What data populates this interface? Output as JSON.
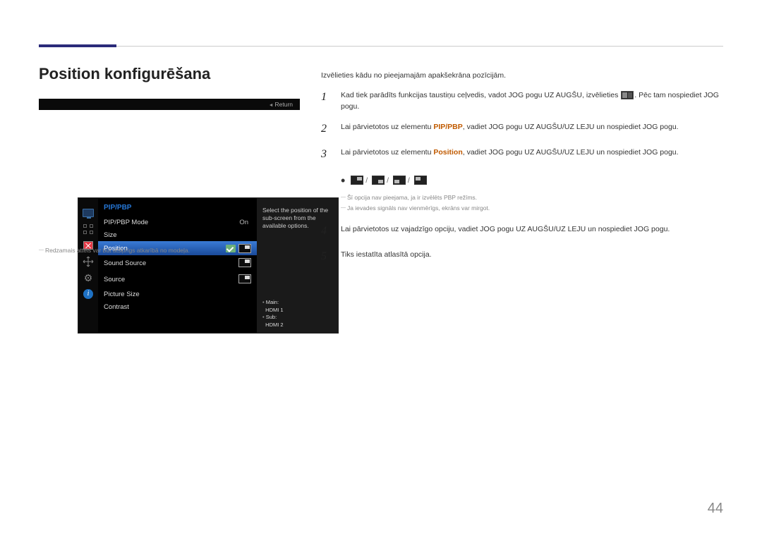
{
  "page_number": "44",
  "title": "Position konfigurēšana",
  "image_disclaimer": "Redzamais attēls var būt atšķirīgs atkarībā no modeļa.",
  "osd": {
    "header": "PIP/PBP",
    "rows": [
      {
        "label": "PIP/PBP Mode",
        "value": "On"
      },
      {
        "label": "Size"
      },
      {
        "label": "Position"
      },
      {
        "label": "Sound Source"
      },
      {
        "label": "Source"
      },
      {
        "label": "Picture Size"
      },
      {
        "label": "Contrast"
      }
    ],
    "info_text": "Select the position of the sub-screen from the available options.",
    "main_label": "Main:",
    "main_value": "HDMI 1",
    "sub_label": "Sub:",
    "sub_value": "HDMI 2",
    "return": "Return"
  },
  "instructions": {
    "intro": "Izvēlieties kādu no pieejamajām apakšekrāna pozīcijām.",
    "step1_a": "Kad tiek parādīts funkcijas taustiņu ceļvedis, vadot JOG pogu UZ AUGŠU, izvēlieties ",
    "step1_b": ". Pēc tam nospiediet JOG pogu.",
    "step2_a": "Lai pārvietotos uz elementu ",
    "step2_hl": "PIP/PBP",
    "step2_b": ", vadiet JOG pogu UZ AUGŠU/UZ LEJU un nospiediet JOG pogu.",
    "step3_a": "Lai pārvietotos uz elementu ",
    "step3_hl": "Position",
    "step3_b": ", vadiet JOG pogu UZ AUGŠU/UZ LEJU un nospiediet JOG pogu.",
    "note1": "Šī opcija nav pieejama, ja ir izvēlēts PBP režīms.",
    "note2": "Ja ievades signāls nav vienmērīgs, ekrāns var mirgot.",
    "step4": "Lai pārvietotos uz vajadzīgo opciju, vadiet JOG pogu UZ AUGŠU/UZ LEJU un nospiediet JOG pogu.",
    "step5": "Tiks iestatīta atlasītā opcija."
  }
}
